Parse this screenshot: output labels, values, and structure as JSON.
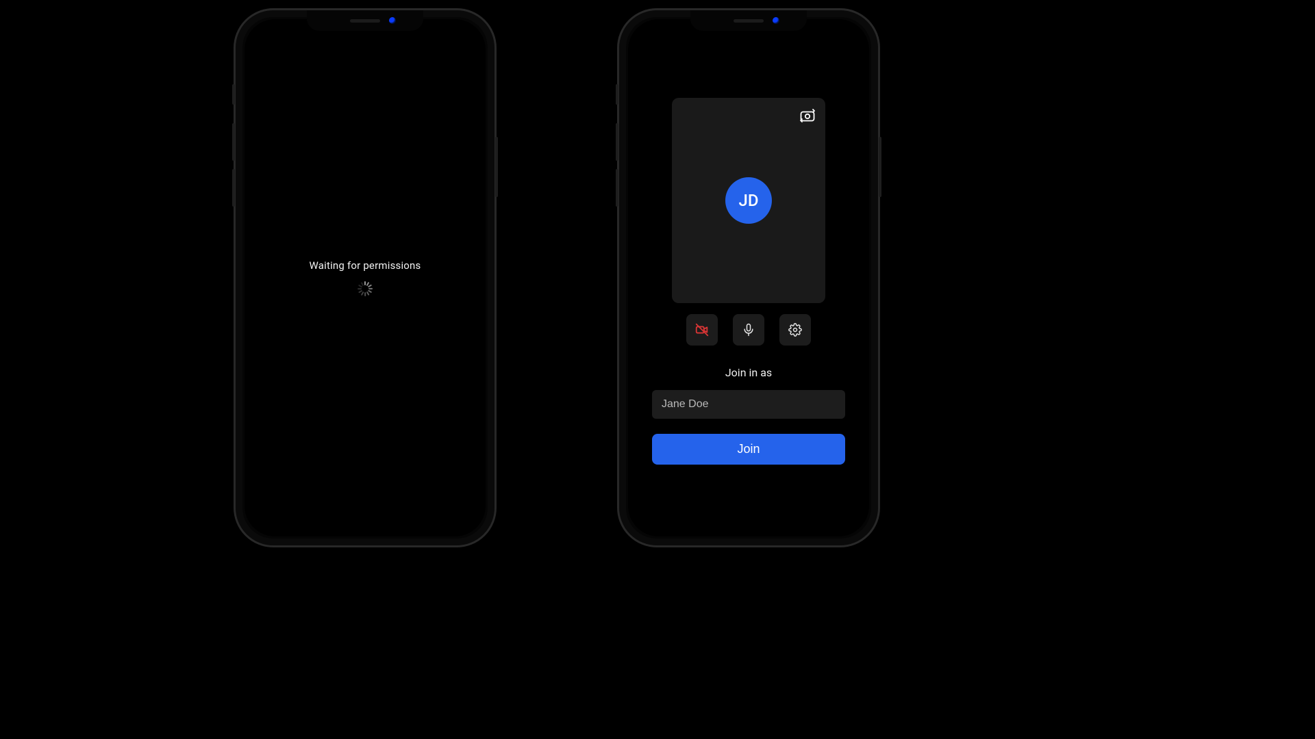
{
  "left": {
    "loading_text": "Waiting  for permissions"
  },
  "right": {
    "preview": {
      "avatar_initials": "JD"
    },
    "join_section": {
      "label": "Join in as",
      "name_value": "Jane Doe",
      "join_label": "Join"
    }
  },
  "colors": {
    "accent": "#2563eb",
    "card": "#1a1a1a",
    "control": "#1c1c1c",
    "danger": "#d93535"
  }
}
